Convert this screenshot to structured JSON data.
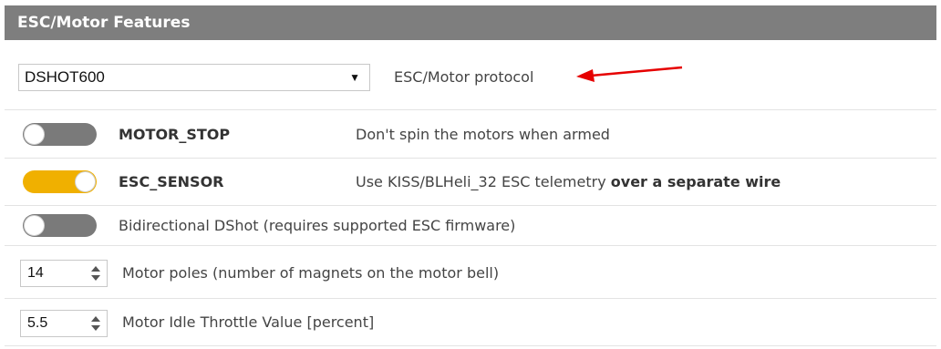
{
  "header": {
    "title": "ESC/Motor Features"
  },
  "protocol": {
    "selected": "DSHOT600",
    "label": "ESC/Motor protocol"
  },
  "features": [
    {
      "name": "MOTOR_STOP",
      "description": "Don't spin the motors when armed",
      "enabled": false
    },
    {
      "name": "ESC_SENSOR",
      "description": "Use KISS/BLHeli_32 ESC telemetry ",
      "description_bold": "over a separate wire",
      "enabled": true
    },
    {
      "name": "",
      "description": "Bidirectional DShot (requires supported ESC firmware)",
      "enabled": false
    }
  ],
  "motor_poles": {
    "value": "14",
    "label": "Motor poles (number of magnets on the motor bell)"
  },
  "idle_throttle": {
    "value": "5.5",
    "label": "Motor Idle Throttle Value [percent]"
  },
  "colors": {
    "header_bg": "#7e7e7e",
    "toggle_on": "#f0b000",
    "toggle_off": "#7a7a7a",
    "arrow": "#e60000"
  }
}
